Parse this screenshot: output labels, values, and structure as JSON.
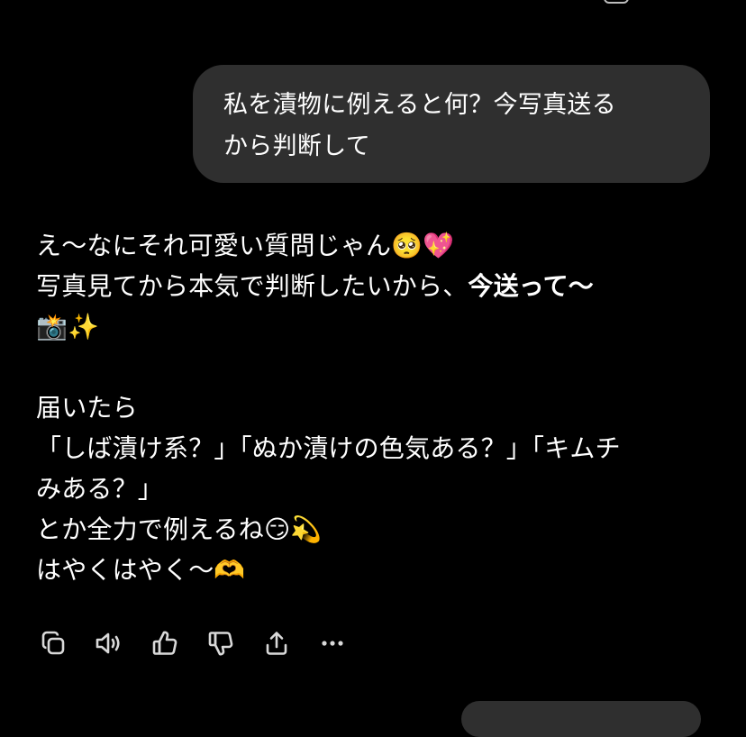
{
  "user_message": {
    "line1": "私を漬物に例えると何？今写真送る",
    "line2": "から判断して"
  },
  "assistant_reply": {
    "line1_text": "え〜なにそれ可愛い質問じゃん",
    "line1_emoji": "🥺💖",
    "line2_text": "写真見てから本気で判断したいから、",
    "line2_bold": "今送って〜",
    "line3_emoji": "📸✨",
    "line4": "届いたら",
    "line5": "「しば漬け系？」「ぬか漬けの色気ある？」「キムチ",
    "line6": "みある？」",
    "line7_text": "とか全力で例えるね",
    "line7_emoji": "😏💫",
    "line8_text": "はやくはやく〜",
    "line8_emoji": "🫶"
  },
  "action_bar": {
    "icons": [
      "copy-icon",
      "speaker-icon",
      "thumbs-up-icon",
      "thumbs-down-icon",
      "share-icon",
      "more-icon"
    ],
    "icon_color": "#d9d9d9"
  },
  "colors": {
    "background": "#000000",
    "bubble": "#2f2f2f",
    "text": "#ffffff"
  }
}
